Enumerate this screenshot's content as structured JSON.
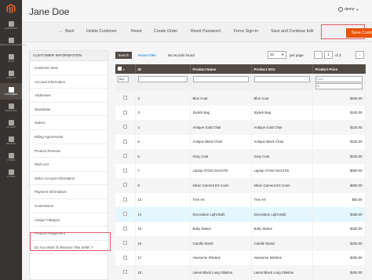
{
  "sidebar": {
    "items": [
      {
        "label": "Dashboard"
      },
      {
        "label": "Marketplace Management"
      },
      {
        "label": "Sales"
      },
      {
        "label": "Catalog"
      },
      {
        "label": "Customers",
        "active": true
      },
      {
        "label": "Marketing"
      },
      {
        "label": "Content"
      },
      {
        "label": "Reports"
      },
      {
        "label": "Stores"
      },
      {
        "label": "System"
      }
    ]
  },
  "header": {
    "title": "Jane Doe",
    "user": "demo"
  },
  "actions": {
    "back": "Back",
    "delete": "Delete Customer",
    "reset": "Reset",
    "create_order": "Create Order",
    "reset_password": "Reset Password",
    "force_signin": "Force Sign-In",
    "save_continue": "Save and Continue Edit",
    "save": "Save Customer"
  },
  "tabs": {
    "heading": "CUSTOMER INFORMATION",
    "items": [
      "Customer View",
      "Account Information",
      "Addresses",
      "Newsletter",
      "Orders",
      "Billing Agreements",
      "Product Reviews",
      "Wish List",
      "Seller Account Information",
      "Payment Information",
      "Commission",
      "Assign Category",
      "Product Assignment",
      "Do You Want To Remove This Seller ?"
    ]
  },
  "grid": {
    "search_label": "Search",
    "reset_filter": "Reset Filter",
    "records": "56 records found",
    "per_page_value": "20",
    "per_page_label": "per page",
    "page": "1",
    "of_pages": "of 3",
    "columns": [
      "",
      "ID",
      "Product Name",
      "Product SKU",
      "Product Price"
    ],
    "filter": {
      "any": "Any",
      "from": "From",
      "to": "To"
    },
    "rows": [
      {
        "id": "2",
        "name": "Blue Coat",
        "sku": "Blue Coat",
        "price": "$345.00"
      },
      {
        "id": "3",
        "name": "Stylish Bag",
        "sku": "Stylish Bag",
        "price": "$100.00"
      },
      {
        "id": "4",
        "name": "Antique Gold Chair",
        "sku": "Antique Gold Chair",
        "price": "$125.00"
      },
      {
        "id": "5",
        "name": "Antique Black Chair",
        "sku": "Antique Black Chair",
        "price": "$125.00"
      },
      {
        "id": "6",
        "name": "Gray Coat",
        "sku": "Gray Coat",
        "price": "$345.00"
      },
      {
        "id": "7",
        "name": "Laptop i7/2nd Gen/1TB",
        "sku": "Laptop i7/2nd Gen/1TB",
        "price": "$800.00"
      },
      {
        "id": "8",
        "name": "Nikon Camera EX zoom",
        "sku": "Nikon Camera EX zoom",
        "price": "$650.00"
      },
      {
        "id": "13",
        "name": "Tree Art",
        "sku": "Tree Art",
        "price": "$50.00"
      },
      {
        "id": "14",
        "name": "Decoration Light Bulb",
        "sku": "Decoration Light Bulb",
        "price": "$456.00"
      },
      {
        "id": "15",
        "name": "Baby Statue",
        "sku": "Baby Statue",
        "price": "$250.00"
      },
      {
        "id": "16",
        "name": "Candle Stand",
        "sku": "Candle Stand",
        "price": "$100.00"
      },
      {
        "id": "17",
        "name": "Awesome Stilettos",
        "sku": "Awesome Stilettos",
        "price": "$250.00"
      },
      {
        "id": "18",
        "name": "Latest Black Long Stilettos",
        "sku": "Latest Black Long Stilettos",
        "price": "$200.00"
      }
    ]
  }
}
